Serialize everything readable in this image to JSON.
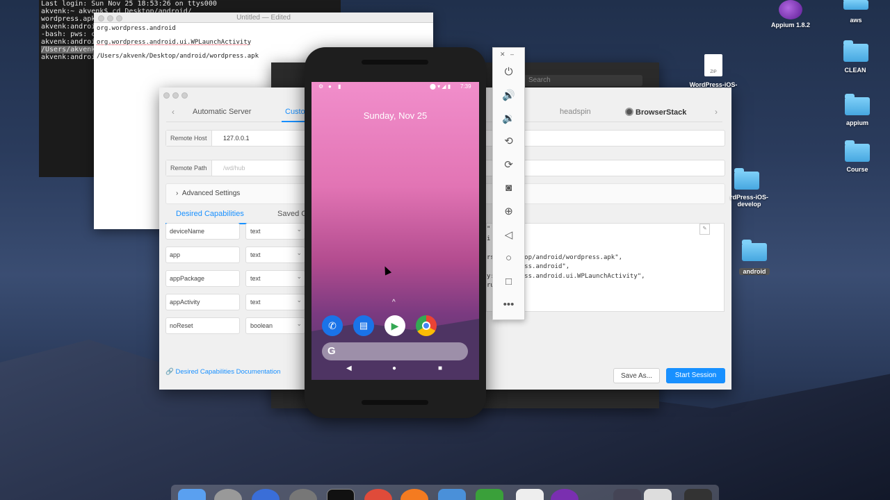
{
  "terminal": {
    "lines": [
      "Last login: Sun Nov 25 18:53:26 on ttys000",
      "akvenk:~ akvenk$ cd Desktop/android/",
      "wordpress.apk",
      "akvenk:android",
      "-bash: pws: co",
      "akvenk:android",
      "/Users/akvenk/",
      "akvenk:android"
    ]
  },
  "textedit": {
    "title": "Untitled — Edited",
    "lines": [
      "org.wordpress.android",
      "org.wordpress.android.ui.WPLaunchActivity",
      "/Users/akvenk/Desktop/android/wordpress.apk"
    ]
  },
  "dark_window": {
    "search_placeholder": "Search"
  },
  "appium": {
    "tabs": {
      "automatic": "Automatic Server",
      "custom": "Custo",
      "headspin": "headspin",
      "browserstack": "BrowserStack"
    },
    "remote_host": {
      "label": "Remote Host",
      "value": "127.0.0.1"
    },
    "remote_path": {
      "label": "Remote Path",
      "placeholder": "/wd/hub"
    },
    "advanced": "Advanced Settings",
    "cap_tabs": {
      "desired": "Desired Capabilities",
      "saved": "Saved C"
    },
    "caps": [
      {
        "name": "deviceName",
        "type": "text"
      },
      {
        "name": "app",
        "type": "text"
      },
      {
        "name": "appPackage",
        "type": "text"
      },
      {
        "name": "appActivity",
        "type": "text"
      },
      {
        "name": "noReset",
        "type": "boolean"
      }
    ],
    "json_lines": [
      "\"    d\",",
      "i    .0\",",
      "     \",",
      "rs   Desktop/android/wordpress.apk\",",
      "     rdpress.android\",",
      "y:   rdpress.android.ui.WPLaunchActivity\",",
      "ru"
    ],
    "doc_link": "Desired Capabilities Documentation",
    "save_as": "Save As...",
    "start_session": "Start Session"
  },
  "phone": {
    "time": "7:39",
    "date": "Sunday, Nov 25",
    "google": "G"
  },
  "emulator_controls": [
    "power-icon",
    "volume-up-icon",
    "volume-down-icon",
    "rotate-left-icon",
    "rotate-right-icon",
    "camera-icon",
    "zoom-icon",
    "back-icon",
    "home-icon",
    "overview-icon",
    "more-icon"
  ],
  "desktop": {
    "appium": "Appium 1.8.2",
    "aws": "aws",
    "clean": "CLEAN",
    "appium_folder": "appium",
    "course": "Course",
    "wp_ios": "WordPress-iOS-",
    "wp_ios_dev": "rdPress-iOS-develop",
    "android": "android",
    "zip": "ZIP"
  }
}
